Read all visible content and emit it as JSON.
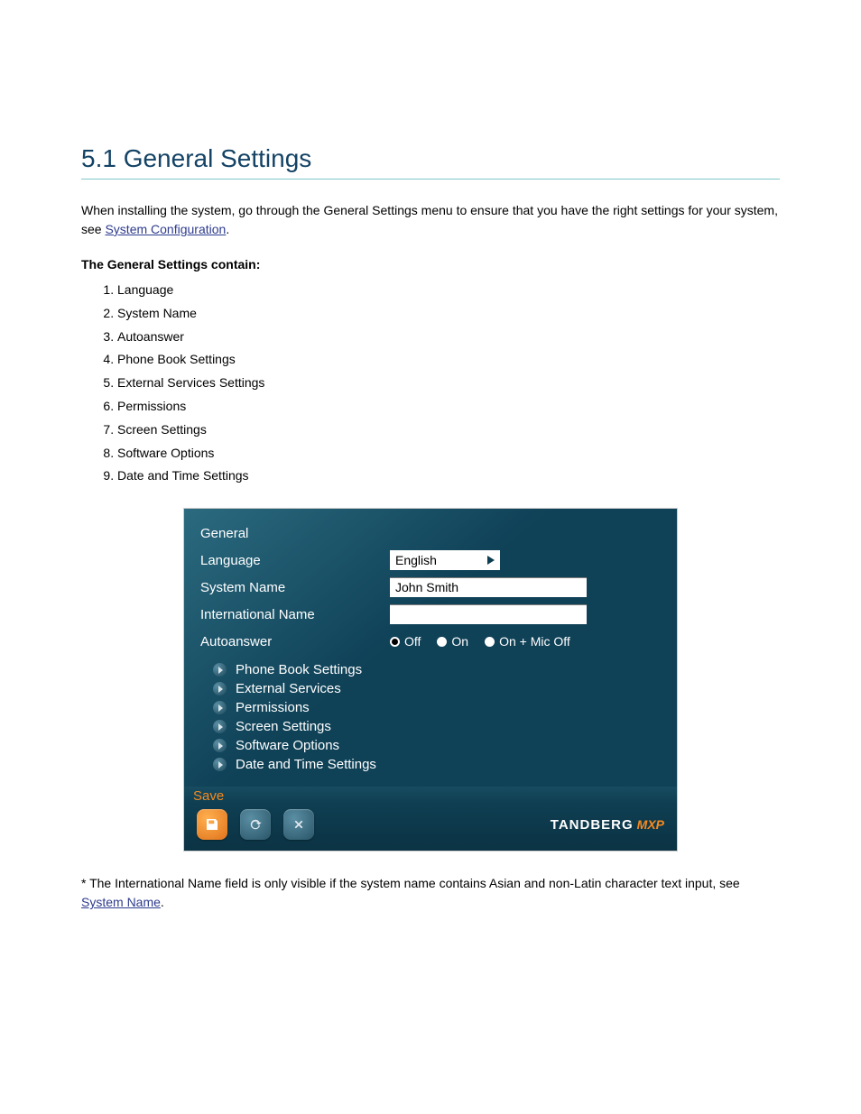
{
  "section": {
    "title": "5.1 General Settings",
    "intro_prefix": "When installing the system, go through the General Settings menu to ensure that you have the right settings for your system, see ",
    "intro_link": "System Configuration",
    "intro_suffix": "."
  },
  "list": {
    "heading": "The General Settings contain:",
    "items": [
      "Language",
      "System Name",
      "Autoanswer",
      "Phone Book Settings",
      "External Services Settings",
      "Permissions",
      "Screen Settings",
      "Software Options",
      "Date and Time Settings"
    ]
  },
  "note": {
    "prefix": "* The International Name field is only visible if the system name contains Asian and non-Latin character text input, see ",
    "link": "System Name",
    "suffix": "."
  },
  "ui": {
    "heading": "General",
    "rows": {
      "language": {
        "label": "Language",
        "value": "English"
      },
      "system_name": {
        "label": "System Name",
        "value": "John Smith"
      },
      "intl_name": {
        "label": "International Name",
        "value": ""
      },
      "autoanswer": {
        "label": "Autoanswer",
        "options": [
          "Off",
          "On",
          "On + Mic Off"
        ],
        "selected": "Off"
      }
    },
    "submenus": [
      "Phone Book Settings",
      "External Services",
      "Permissions",
      "Screen Settings",
      "Software Options",
      "Date and Time Settings"
    ],
    "save_label": "Save",
    "brand": {
      "main": "TANDBERG",
      "sub": "MXP"
    }
  }
}
